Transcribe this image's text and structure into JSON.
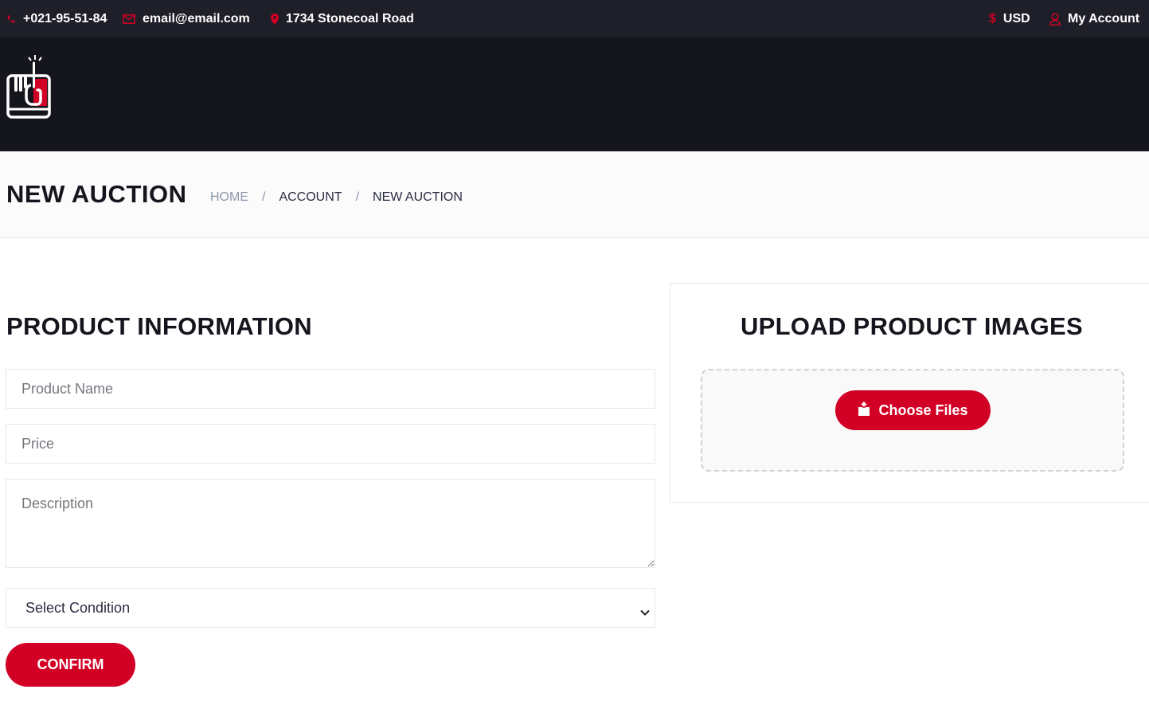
{
  "topbar": {
    "phone": "+021-95-51-84",
    "email": "email@email.com",
    "address": "1734 Stonecoal Road",
    "currency": "USD",
    "account": "My Account"
  },
  "header": {
    "logo_icon": "hand-pointing-up-logo"
  },
  "breadcrumb": {
    "title": "NEW AUCTION",
    "items": [
      "HOME",
      "ACCOUNT",
      "NEW AUCTION"
    ],
    "separator": "/"
  },
  "product_form": {
    "heading": "PRODUCT INFORMATION",
    "name_placeholder": "Product Name",
    "price_placeholder": "Price",
    "description_placeholder": "Description",
    "condition_selected": "Select Condition",
    "confirm_label": "CONFIRM"
  },
  "upload": {
    "heading": "UPLOAD PRODUCT IMAGES",
    "button_label": "Choose Files"
  },
  "colors": {
    "accent": "#d10024",
    "topbar_bg": "#1e1f29",
    "header_bg": "#15161d"
  }
}
